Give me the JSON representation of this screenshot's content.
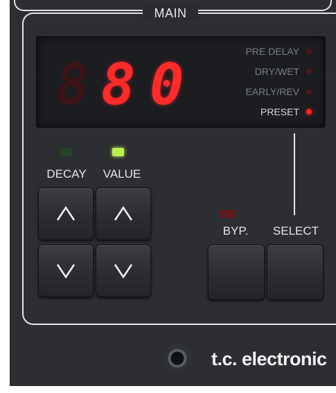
{
  "section_title": "MAIN",
  "display": {
    "digit_1": "8",
    "digit_2": "8",
    "digit_3": "0"
  },
  "menu": [
    {
      "label": "PRE DELAY",
      "active": false
    },
    {
      "label": "DRY/WET",
      "active": false
    },
    {
      "label": "EARLY/REV",
      "active": false
    },
    {
      "label": "PRESET",
      "active": true
    }
  ],
  "controls": {
    "decay_label": "DECAY",
    "value_label": "VALUE",
    "byp_label": "BYP.",
    "select_label": "SELECT"
  },
  "leds": {
    "decay": "off",
    "value": "on",
    "byp": "off"
  },
  "colors": {
    "panel": "#2a2c30",
    "led_red": "#ff2a2a",
    "led_green": "#b9f04e",
    "frame_line": "#e6e6e6"
  },
  "icons": {
    "up": "up-arrow-icon",
    "down": "down-arrow-icon",
    "jack": "input-jack-icon"
  },
  "brand": "t.c. electronic"
}
